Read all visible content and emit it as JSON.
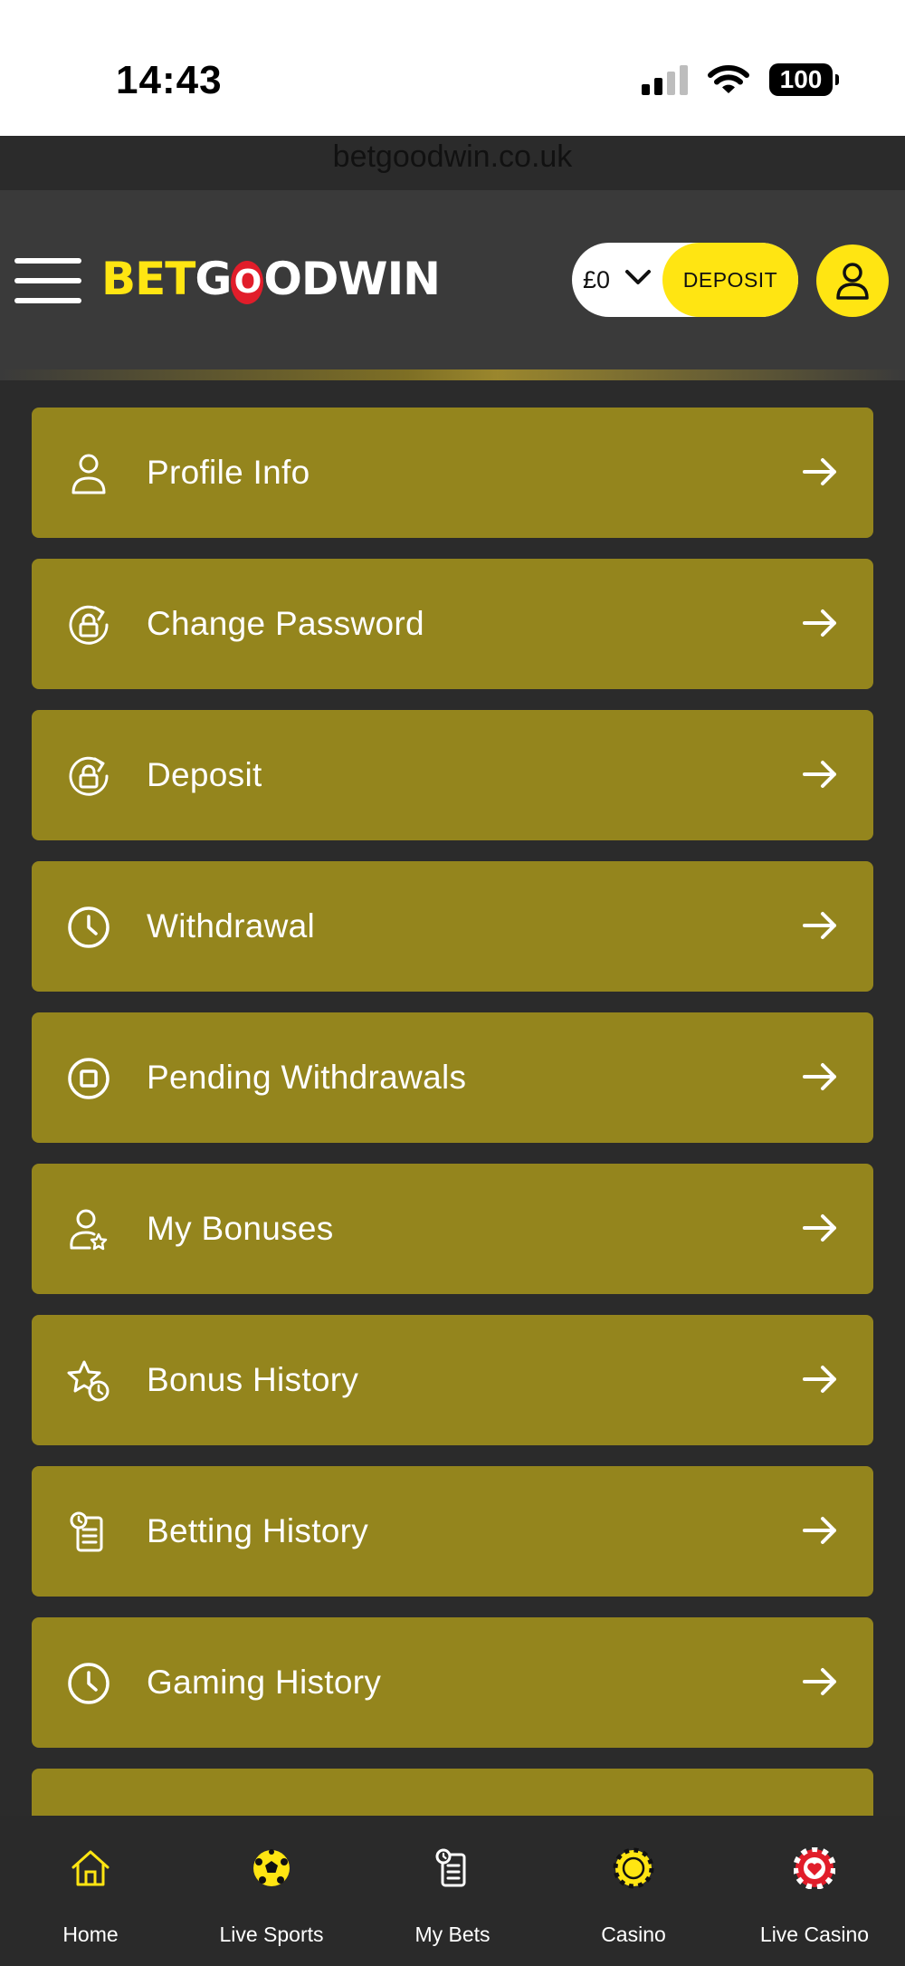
{
  "status_bar": {
    "time": "14:43",
    "battery": "100"
  },
  "browser": {
    "url": "betgoodwin.co.uk"
  },
  "header": {
    "logo": {
      "bet": "BET",
      "g": "G",
      "o": "O",
      "rest": "ODWIN"
    },
    "balance": "£0",
    "deposit_label": "DEPOSIT"
  },
  "colors": {
    "brand_yellow": "#ffe512",
    "menu_gold": "#94851d",
    "header_bg": "#3a3a3a",
    "page_bg": "#2b2b2b",
    "logo_red": "#e11d2a"
  },
  "menu": {
    "items": [
      {
        "label": "Profile Info",
        "icon": "user-icon"
      },
      {
        "label": "Change Password",
        "icon": "lock-refresh-icon"
      },
      {
        "label": "Deposit",
        "icon": "lock-refresh-icon"
      },
      {
        "label": "Withdrawal",
        "icon": "clock-icon"
      },
      {
        "label": "Pending Withdrawals",
        "icon": "stop-circle-icon"
      },
      {
        "label": "My Bonuses",
        "icon": "user-star-icon"
      },
      {
        "label": "Bonus History",
        "icon": "star-clock-icon"
      },
      {
        "label": "Betting History",
        "icon": "clipboard-clock-icon"
      },
      {
        "label": "Gaming History",
        "icon": "clock-icon"
      }
    ]
  },
  "bottom_nav": {
    "items": [
      {
        "label": "Home",
        "icon": "home-icon"
      },
      {
        "label": "Live Sports",
        "icon": "football-icon"
      },
      {
        "label": "My Bets",
        "icon": "betslip-icon"
      },
      {
        "label": "Casino",
        "icon": "casino-chip-icon"
      },
      {
        "label": "Live Casino",
        "icon": "live-casino-icon"
      }
    ]
  }
}
